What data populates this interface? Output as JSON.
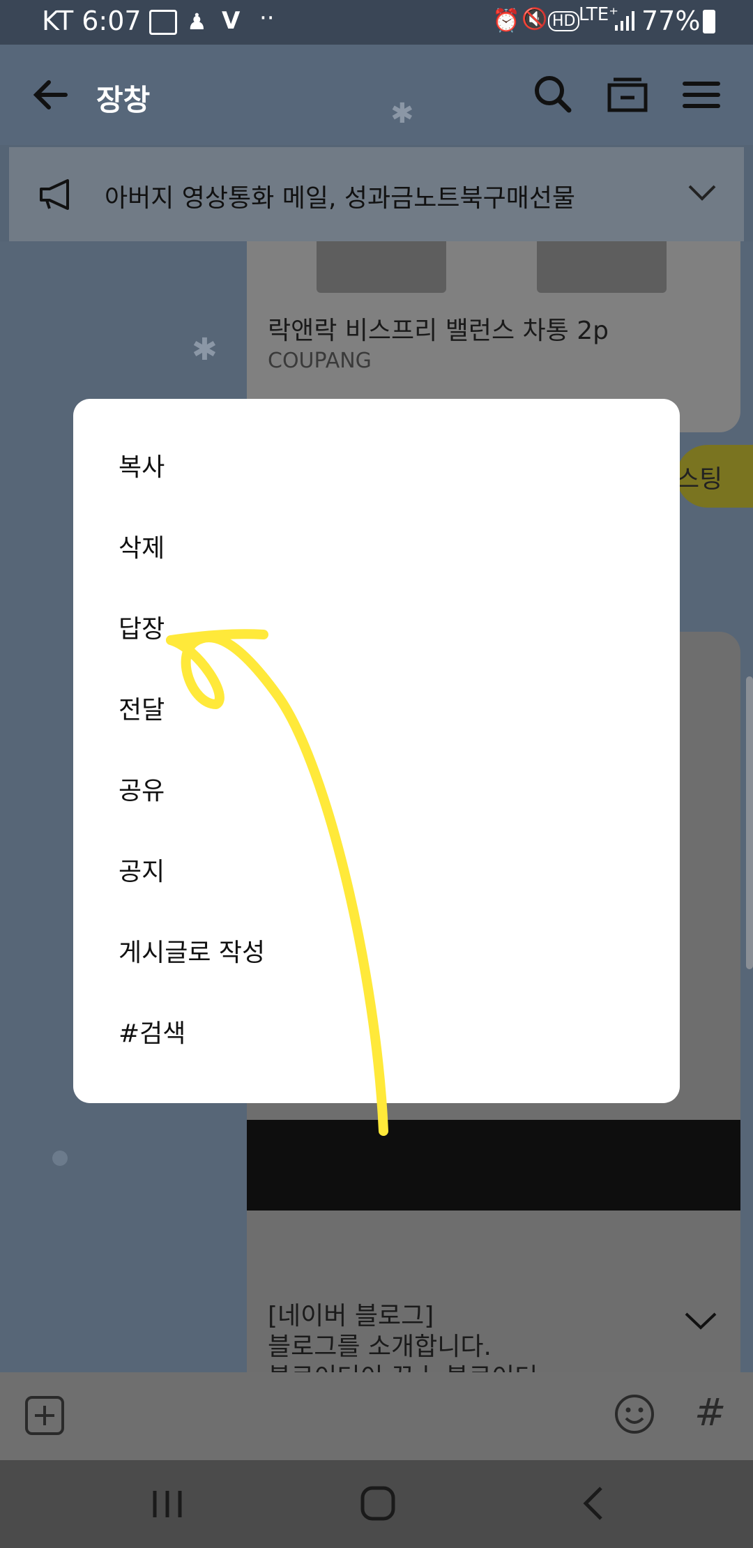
{
  "status_bar": {
    "carrier_time": "KT 6:07",
    "battery": "77%",
    "network": "LTE⁺",
    "hd": "HD"
  },
  "header": {
    "title": "장창"
  },
  "notice": {
    "text": "아버지 영상통화 메일, 성과금노트북구매선물"
  },
  "chat": {
    "link_card": {
      "title": "락앤락 비스프리 밸런스 차통 2p",
      "source": "COUPANG"
    },
    "yellow_bubble_text": "스팅",
    "blog_card": {
      "line1": "[네이버 블로그]",
      "line2": "블로그를 소개합니다.",
      "line3": "블로이더이 꾸ㅣ 블로이더"
    }
  },
  "context_menu": {
    "items": [
      {
        "label": "복사"
      },
      {
        "label": "삭제"
      },
      {
        "label": "답장"
      },
      {
        "label": "전달"
      },
      {
        "label": "공유"
      },
      {
        "label": "공지"
      },
      {
        "label": "게시글로 작성"
      },
      {
        "label": "#검색"
      }
    ]
  },
  "input_bar": {
    "hash": "#"
  },
  "colors": {
    "highlight_arrow": "#ffe93a",
    "dialog": "#ffffff"
  }
}
